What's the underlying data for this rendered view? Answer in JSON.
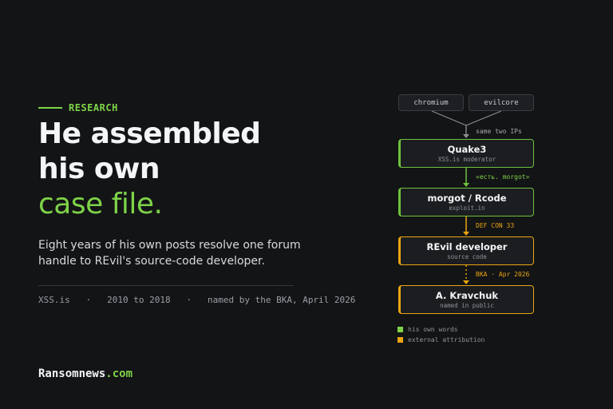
{
  "tag": "RESEARCH",
  "headline": {
    "line1": "He assembled",
    "line2": "his own",
    "accent": "case file."
  },
  "subtitle": "Eight years of his own posts resolve one forum handle to REvil's source-code developer.",
  "meta": {
    "forum": "XSS.is",
    "period": "2010 to 2018",
    "attribution": "named by the BKA, April 2026",
    "separator": "·"
  },
  "brand": {
    "name": "Ransomnews",
    "tld": ".com"
  },
  "diagram": {
    "sources": [
      "chromium",
      "evilcore"
    ],
    "nodes": [
      {
        "title": "Quake3",
        "sub": "XSS.is moderator",
        "kind": "own"
      },
      {
        "title": "morgot / Rcode",
        "sub": "exploit.in",
        "kind": "own"
      },
      {
        "title": "REvil developer",
        "sub": "source code",
        "kind": "external"
      },
      {
        "title": "A. Kravchuk",
        "sub": "named in public",
        "kind": "external"
      }
    ],
    "edges": [
      {
        "label": "same two IPs",
        "kind": "neutral"
      },
      {
        "label": "«есть. morgot»",
        "kind": "own"
      },
      {
        "label": "DEF CON 33",
        "kind": "external"
      },
      {
        "label": "BKA · Apr 2026",
        "kind": "external"
      }
    ],
    "legend": [
      {
        "label": "his own words",
        "color": "#7ed348"
      },
      {
        "label": "external attribution",
        "color": "#e9a512"
      }
    ],
    "colors": {
      "own": "#6ec23d",
      "external": "#e9a512",
      "neutral": "#8c9096"
    }
  }
}
